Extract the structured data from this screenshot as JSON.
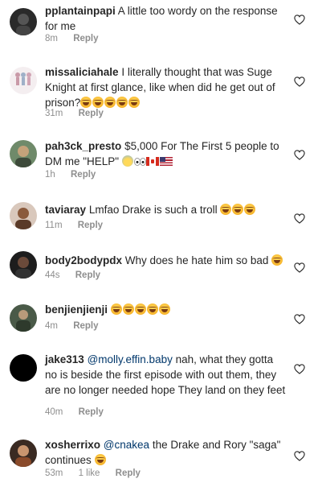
{
  "comments": [
    {
      "username": "pplantainpapi",
      "text": "A little too wordy on the response for me",
      "time": "8m",
      "likes": "",
      "reply": "Reply"
    },
    {
      "username": "missaliciahale",
      "text": "I literally thought that was Suge Knight at first glance, like when did he get out of prison?",
      "time": "31m",
      "likes": "",
      "reply": "Reply",
      "emoji": [
        "face-with-tears-of-joy",
        "face-with-tears-of-joy",
        "face-with-tears-of-joy",
        "face-with-tears-of-joy",
        "face-with-tears-of-joy"
      ]
    },
    {
      "username": "pah3ck_presto",
      "text": "$5,000 For The First 5 people to DM me \"HELP\"",
      "time": "1h",
      "likes": "",
      "reply": "Reply",
      "emoji": [
        "face-screaming",
        "eyes",
        "flag-canada",
        "flag-united-states"
      ]
    },
    {
      "username": "taviaray",
      "text": "Lmfao Drake is such a troll",
      "time": "11m",
      "likes": "",
      "reply": "Reply",
      "emoji": [
        "face-with-tears-of-joy",
        "face-with-tears-of-joy",
        "face-with-tears-of-joy"
      ]
    },
    {
      "username": "body2bodypdx",
      "text": "Why does he hate him so bad",
      "time": "44s",
      "likes": "",
      "reply": "Reply",
      "emoji": [
        "face-with-tears-of-joy"
      ]
    },
    {
      "username": "benjienjienji",
      "text": "",
      "time": "4m",
      "likes": "",
      "reply": "Reply",
      "emoji": [
        "face-with-tears-of-joy",
        "face-with-tears-of-joy",
        "face-with-tears-of-joy",
        "face-with-tears-of-joy",
        "face-with-tears-of-joy"
      ]
    },
    {
      "username": "jake313",
      "mention": "@molly.effin.baby",
      "text": "nah, what they gotta no is beside the first episode with out them, they are no longer needed hope They land on they feet",
      "time": "40m",
      "likes": "",
      "reply": "Reply"
    },
    {
      "username": "xosherrixo",
      "mention": "@cnakea",
      "text": "the Drake and Rory \"saga\" continues",
      "time": "53m",
      "likes": "1 like",
      "reply": "Reply",
      "emoji": [
        "face-with-tears-of-joy"
      ]
    }
  ],
  "colors": {
    "text": "#262626",
    "meta": "#8e8e8e",
    "mention": "#00376b",
    "heart_stroke": "#262626"
  }
}
